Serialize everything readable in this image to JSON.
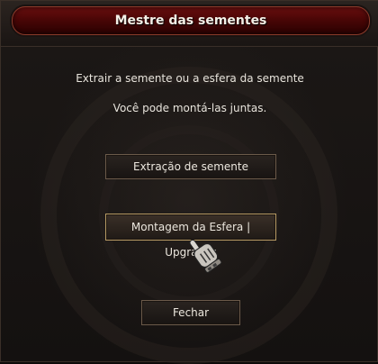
{
  "window": {
    "title": "Mestre das sementes"
  },
  "message": {
    "line1": "Extrair a semente ou a esfera da semente",
    "line2": "Você pode montá-las juntas."
  },
  "buttons": {
    "extract_label": "Extração de semente",
    "assemble_label": "Montagem da Esfera | Upgrades",
    "close_label": "Fechar"
  },
  "icons": {
    "cursor": "hand-cursor-icon"
  },
  "colors": {
    "title_bar": "#5a0a0a",
    "button_border": "#6b5a4a",
    "button_highlight_border": "#b79a64",
    "text": "#e8e4dc"
  }
}
